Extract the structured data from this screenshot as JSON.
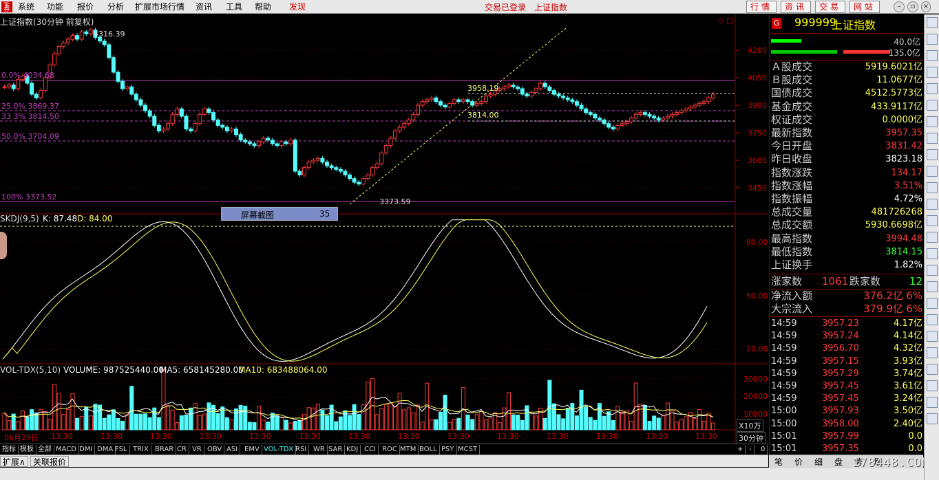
{
  "menu": {
    "items": [
      "系统",
      "功能",
      "报价",
      "分析",
      "扩展市场行情",
      "资讯",
      "工具",
      "帮助"
    ],
    "discover": "发现",
    "status_login": "交易已登录",
    "status_index": "上证指数",
    "buttons": [
      "行情",
      "资讯",
      "交易",
      "网站"
    ]
  },
  "chart": {
    "title": "上证指数(30分钟 前复权)",
    "high_label": "4316.39",
    "low_label": "3373.59",
    "fib": [
      "0.0% 4034.68",
      "25.0% 3869.37",
      "33.3% 3814.50",
      "50.0% 3704.09",
      "100% 3373.52"
    ],
    "price_labels": [
      "3958.19",
      "3814.00"
    ],
    "price_axis": [
      "4200",
      "4050",
      "3900",
      "3750",
      "3600",
      "3450"
    ],
    "screenshot_box": {
      "label": "屏幕截图",
      "value": "35"
    },
    "skdj_title": "SKDJ(9,5)",
    "skdj_k": "K: 87.48",
    "skdj_d": "D: 84.00",
    "skdj_axis": [
      "80.00",
      "50.00",
      "20.00"
    ],
    "vol_title": "VOL-TDX(5,10)",
    "vol_volume": "VOLUME: 987525440.00",
    "vol_ma5": "MA5: 658145280.00",
    "vol_ma10": "MA10: 683488064.00",
    "vol_axis": [
      "30000",
      "20000",
      "10000"
    ],
    "vol_unit": "X10万",
    "period": "30分钟",
    "date_first": "06月29日",
    "time_tick": "13:30",
    "colors": {
      "up": "#ff3c3c",
      "down": "#54fcfc",
      "fib": "#c040c0",
      "k": "#ffffff",
      "d": "#ffff60"
    }
  },
  "indicator_tabs": [
    "指标",
    "模板",
    "全部",
    "MACD",
    "DMI",
    "DMA",
    "FSL",
    "TRIX",
    "BRAR",
    "CR",
    "VR",
    "OBV",
    "ASI",
    "EMV",
    "VOL-TDX",
    "RSI",
    "WR",
    "SAR",
    "KDJ",
    "CCI",
    "ROC",
    "MTM",
    "BOLL",
    "PSY",
    "MCST"
  ],
  "indicator_selected": "VOL-TDX",
  "tab_controls": [
    "+",
    "-",
    "0"
  ],
  "bottom_tabs": [
    "扩展∧",
    "关联报价"
  ],
  "quote": {
    "code": "999999",
    "name": "上证指数",
    "bar1": "40.0亿",
    "bar2": "135.0亿",
    "rows": [
      {
        "k": "Ａ股成交",
        "v": "5919.6021亿",
        "c": "#ffff60"
      },
      {
        "k": "Ｂ股成交",
        "v": "11.0677亿",
        "c": "#ffff60"
      },
      {
        "k": "国债成交",
        "v": "4512.5773亿",
        "c": "#ffff60"
      },
      {
        "k": "基金成交",
        "v": "433.9117亿",
        "c": "#ffff60"
      },
      {
        "k": "权证成交",
        "v": "0.0000亿",
        "c": "#ffff60"
      },
      {
        "k": "最新指数",
        "v": "3957.35",
        "c": "#ff3c3c"
      },
      {
        "k": "今日开盘",
        "v": "3831.42",
        "c": "#ff3c3c"
      },
      {
        "k": "昨日收盘",
        "v": "3823.18",
        "c": "#ffffff"
      },
      {
        "k": "指数涨跌",
        "v": "134.17",
        "c": "#ff3c3c"
      },
      {
        "k": "指数涨幅",
        "v": "3.51%",
        "c": "#ff3c3c"
      },
      {
        "k": "指数振幅",
        "v": "4.72%",
        "c": "#ffffff"
      },
      {
        "k": "总成交量",
        "v": "481726268",
        "c": "#ffff60"
      },
      {
        "k": "总成交额",
        "v": "5930.6698亿",
        "c": "#ffff60"
      },
      {
        "k": "最高指数",
        "v": "3994.48",
        "c": "#ff3c3c"
      },
      {
        "k": "最低指数",
        "v": "3814.15",
        "c": "#3cff3c"
      },
      {
        "k": "上证换手",
        "v": "1.82%",
        "c": "#ffffff"
      }
    ],
    "rise_label": "涨家数",
    "rise_value": "1061",
    "fall_label": "跌家数",
    "fall_value": "12",
    "net_inflow_label": "净流入额",
    "net_inflow_value": "376.2亿",
    "net_inflow_pct": "6%",
    "block_inflow_label": "大宗流入",
    "block_inflow_value": "379.9亿",
    "block_inflow_pct": "6%",
    "ticks": [
      {
        "t": "14:59",
        "p": "3957.23",
        "v": "4.17亿"
      },
      {
        "t": "14:59",
        "p": "3957.24",
        "v": "4.14亿"
      },
      {
        "t": "14:59",
        "p": "3956.70",
        "v": "4.32亿"
      },
      {
        "t": "14:59",
        "p": "3957.15",
        "v": "3.93亿"
      },
      {
        "t": "14:59",
        "p": "3957.29",
        "v": "3.74亿"
      },
      {
        "t": "14:59",
        "p": "3957.45",
        "v": "3.61亿"
      },
      {
        "t": "14:59",
        "p": "3957.45",
        "v": "3.24亿"
      },
      {
        "t": "15:00",
        "p": "3957.93",
        "v": "3.50亿"
      },
      {
        "t": "15:00",
        "p": "3958.00",
        "v": "2.40亿"
      },
      {
        "t": "15:01",
        "p": "3957.99",
        "v": "0.0"
      },
      {
        "t": "15:01",
        "p": "3957.35",
        "v": "0.0"
      }
    ],
    "bottom_tabs": [
      "笔",
      "价",
      "细",
      "盘",
      "势",
      "联"
    ]
  },
  "watermark": "178448.COM"
}
